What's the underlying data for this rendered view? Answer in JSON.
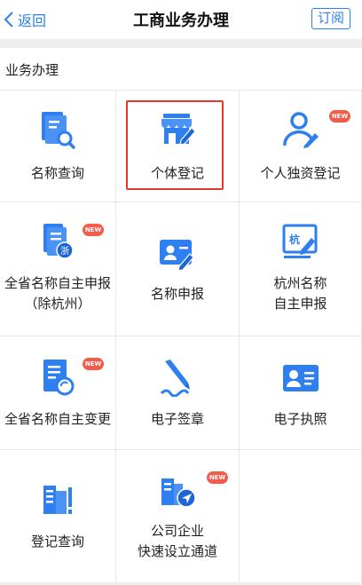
{
  "header": {
    "back_label": "返回",
    "title": "工商业务办理",
    "subscribe_label": "订阅"
  },
  "section": {
    "title": "业务办理"
  },
  "badge_text": "NEW",
  "accent_color": "#2e7ff0",
  "badge_color": "#f35b4a",
  "highlight_color": "#e23b2e",
  "items": [
    {
      "label": "名称查询",
      "icon": "document-search-icon",
      "badge": false
    },
    {
      "label": "个体登记",
      "icon": "storefront-edit-icon",
      "badge": false,
      "highlighted": true
    },
    {
      "label": "个人独资登记",
      "icon": "person-edit-icon",
      "badge": true
    },
    {
      "label": "全省名称自主申报\n（除杭州）",
      "icon": "zhejiang-document-icon",
      "badge": true
    },
    {
      "label": "名称申报",
      "icon": "id-card-edit-icon",
      "badge": false
    },
    {
      "label": "杭州名称\n自主申报",
      "icon": "hangzhou-edit-icon",
      "badge": false
    },
    {
      "label": "全省名称自主变更",
      "icon": "document-refresh-icon",
      "badge": true
    },
    {
      "label": "电子签章",
      "icon": "pen-sign-icon",
      "badge": false
    },
    {
      "label": "电子执照",
      "icon": "license-card-icon",
      "badge": false
    },
    {
      "label": "登记查询",
      "icon": "building-query-icon",
      "badge": false
    },
    {
      "label": "公司企业\n快速设立通道",
      "icon": "building-send-icon",
      "badge": true
    }
  ]
}
